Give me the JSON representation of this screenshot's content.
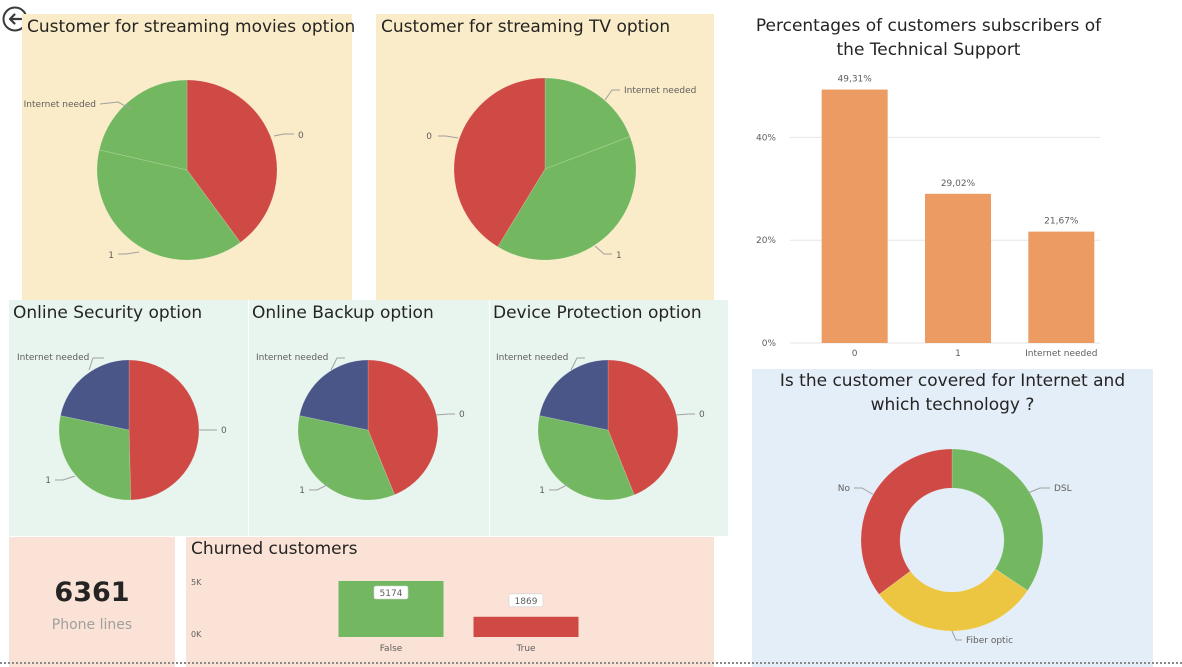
{
  "colors": {
    "red": "#d04a45",
    "green": "#73b860",
    "blue": "#4b5688",
    "orange": "#ec9b63",
    "yellow": "#ecc641",
    "tile_yellow": "#faecc8",
    "tile_mint": "#e8f5ee",
    "tile_peach": "#fae3d6",
    "tile_blue": "#e3eef8"
  },
  "nav": {
    "back_icon": "back-arrow-icon"
  },
  "streaming_movies": {
    "title": "Customer for streaming movies option",
    "labels": {
      "internet_needed": "Internet needed",
      "zero": "0",
      "one": "1"
    },
    "chart_data": {
      "type": "pie",
      "categories": [
        "0",
        "1",
        "Internet needed"
      ],
      "values": [
        39.9,
        38.7,
        21.4
      ],
      "colors": [
        "#d04a45",
        "#73b860",
        "#73b860"
      ]
    }
  },
  "streaming_tv": {
    "title": "Customer for streaming TV option",
    "labels": {
      "internet_needed": "Internet needed",
      "zero": "0",
      "one": "1"
    },
    "chart_data": {
      "type": "pie",
      "categories": [
        "Internet needed",
        "1",
        "0"
      ],
      "values": [
        19.2,
        39.5,
        41.3
      ],
      "colors": [
        "#73b860",
        "#73b860",
        "#d04a45"
      ]
    }
  },
  "online_security": {
    "title": "Online Security option",
    "labels": {
      "internet_needed": "Internet needed",
      "zero": "0",
      "one": "1"
    },
    "chart_data": {
      "type": "pie",
      "categories": [
        "0",
        "1",
        "Internet needed"
      ],
      "values": [
        49.6,
        28.7,
        21.7
      ],
      "colors": [
        "#d04a45",
        "#73b860",
        "#4b5688"
      ]
    }
  },
  "online_backup": {
    "title": "Online Backup option",
    "labels": {
      "internet_needed": "Internet needed",
      "zero": "0",
      "one": "1"
    },
    "chart_data": {
      "type": "pie",
      "categories": [
        "0",
        "1",
        "Internet needed"
      ],
      "values": [
        43.8,
        34.5,
        21.7
      ],
      "colors": [
        "#d04a45",
        "#73b860",
        "#4b5688"
      ]
    }
  },
  "device_protection": {
    "title": "Device Protection option",
    "labels": {
      "internet_needed": "Internet needed",
      "zero": "0",
      "one": "1"
    },
    "chart_data": {
      "type": "pie",
      "categories": [
        "0",
        "1",
        "Internet needed"
      ],
      "values": [
        43.9,
        34.4,
        21.7
      ],
      "colors": [
        "#d04a45",
        "#73b860",
        "#4b5688"
      ]
    }
  },
  "tech_support": {
    "title": "Percentages of customers subscribers of the Technical Support",
    "chart_data": {
      "type": "bar",
      "categories": [
        "0",
        "1",
        "Internet needed"
      ],
      "values": [
        49.31,
        29.02,
        21.67
      ],
      "data_labels": [
        "49,31%",
        "29,02%",
        "21,67%"
      ],
      "y_ticks": [
        "0%",
        "20%",
        "40%"
      ],
      "y_tick_values": [
        0,
        20,
        40
      ],
      "ylim": [
        0,
        50
      ],
      "grid": true,
      "color": "#ec9b63"
    }
  },
  "phone_lines": {
    "value": "6361",
    "label": "Phone lines"
  },
  "churn": {
    "title": "Churned customers",
    "chart_data": {
      "type": "bar",
      "categories": [
        "False",
        "True"
      ],
      "values": [
        5174,
        1869
      ],
      "data_labels": [
        "5174",
        "1869"
      ],
      "y_ticks": [
        "0K",
        "5K"
      ],
      "y_tick_values": [
        0,
        5000
      ],
      "ylim": [
        0,
        5174
      ],
      "colors": [
        "#73b860",
        "#d04a45"
      ]
    }
  },
  "internet": {
    "title": "Is the customer covered for Internet and which technology ?",
    "labels": {
      "dsl": "DSL",
      "fiber": "Fiber optic",
      "no": "No"
    },
    "chart_data": {
      "type": "pie",
      "categories": [
        "DSL",
        "Fiber optic",
        "No"
      ],
      "values": [
        34.4,
        30.4,
        35.2
      ],
      "colors": [
        "#73b860",
        "#ecc641",
        "#d04a45"
      ]
    }
  }
}
